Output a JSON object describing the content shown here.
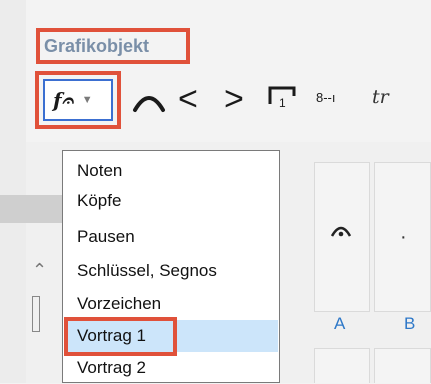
{
  "section": {
    "title": "Grafikobjekt"
  },
  "palette_selector": {
    "glyph": "f𝄐",
    "arrow": "▼",
    "icon": "dynamics-glyph-icon"
  },
  "toolbar": {
    "ottava_label": "8--ı",
    "trill_label": "tr",
    "less_glyph": "<",
    "greater_glyph": ">",
    "icons": [
      "slur-icon",
      "crescendo-icon",
      "decrescendo-icon",
      "volta-bracket-icon",
      "ottava-icon",
      "trill-icon"
    ]
  },
  "dropdown": {
    "options": [
      {
        "label": "Noten"
      },
      {
        "label": "Köpfe"
      },
      {
        "label": "Pausen"
      },
      {
        "label": "Schlüssel, Segnos"
      },
      {
        "label": "Vorzeichen"
      },
      {
        "label": "Vortrag 1"
      },
      {
        "label": "Vortrag 2"
      }
    ],
    "selected": "Vortrag 1"
  },
  "tiles": {
    "labels": [
      "A",
      "B"
    ],
    "glyphs": [
      "fermata-icon",
      "dot-icon"
    ]
  },
  "colors": {
    "highlight_frame": "#e0513a",
    "title_text": "#7a8fa8",
    "selected_row": "#cce5fa",
    "link_blue": "#2e78c8",
    "focus_border": "#3b6fd1"
  }
}
